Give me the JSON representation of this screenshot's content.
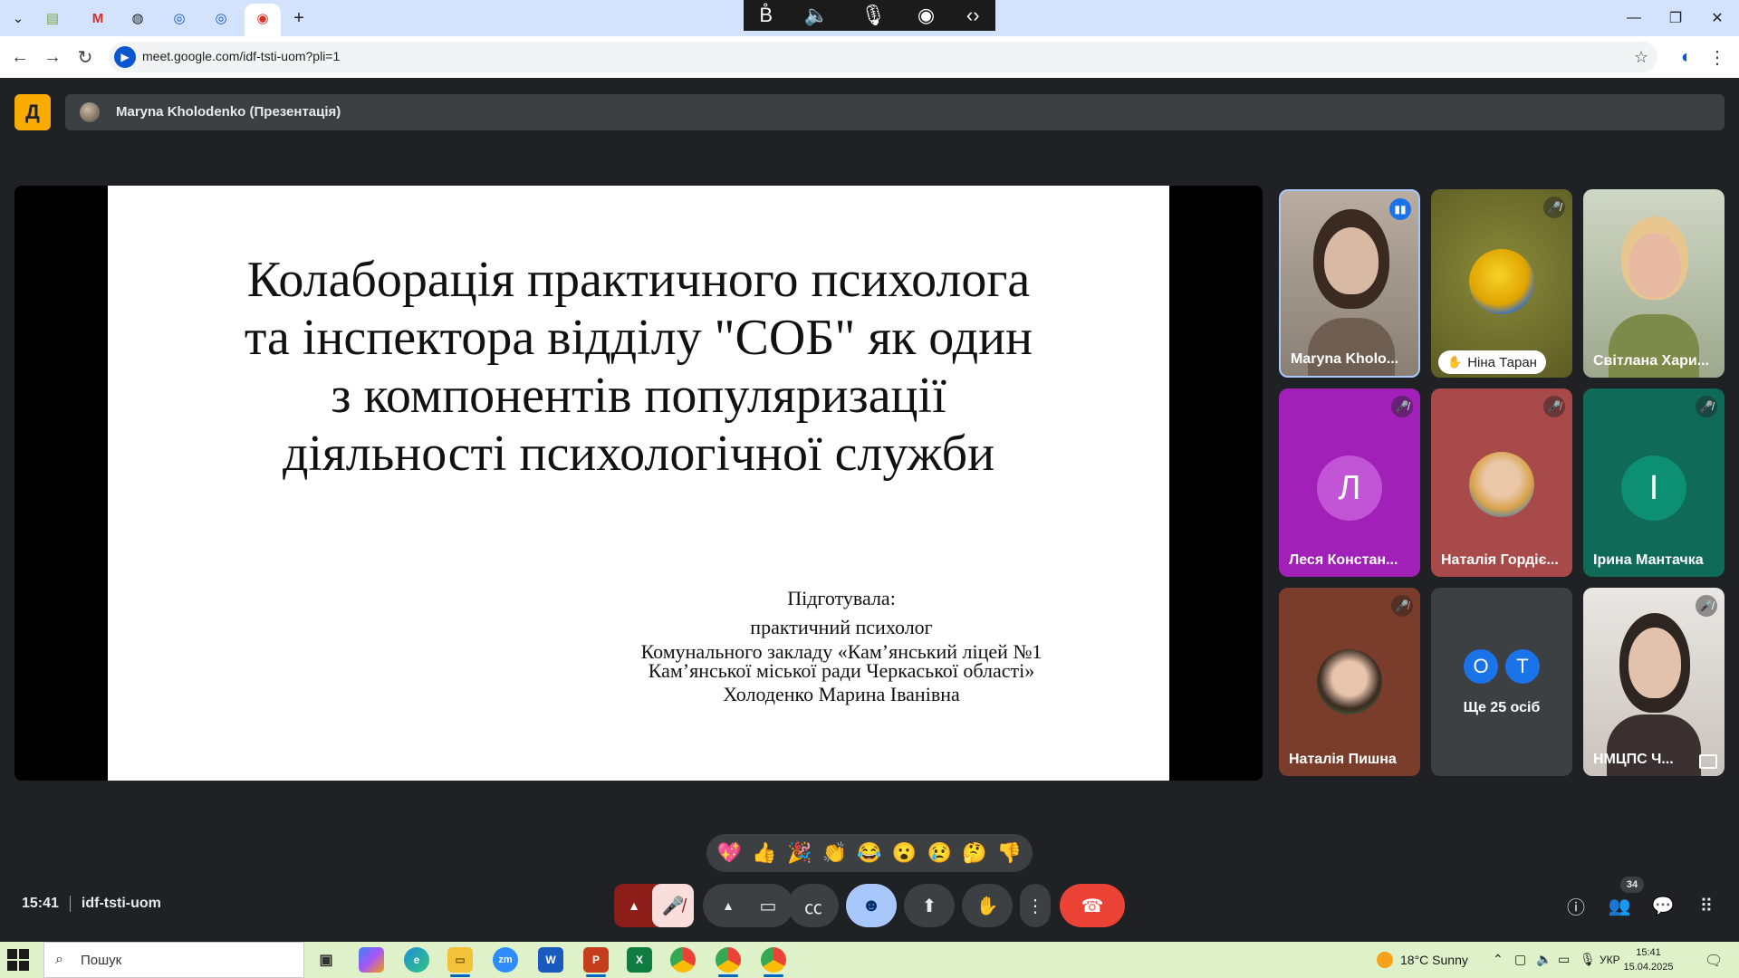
{
  "browser": {
    "url": "meet.google.com/idf-tsti-uom?pli=1",
    "media_overlay_icons": [
      "bo-icon",
      "speaker-icon",
      "mic-icon",
      "broadcast-icon",
      "code-icon"
    ]
  },
  "meet": {
    "logo_letter": "Д",
    "presentation_title": "Maryna Kholodenko (Презентація)",
    "slide": {
      "title": "Колаборація практичного психолога та інспектора відділу \"СОБ\" як один з компонентів популяризації діяльності психологічної служби",
      "prepared_by": "Підготувала:",
      "role": "практичний психолог",
      "org_line1": "Комунального закладу «Кам’янський ліцей №1",
      "org_line2": "Кам’янської міської ради Черкаської області»",
      "author": "Холоденко Марина Іванівна"
    },
    "participants": [
      {
        "name": "Maryna Kholo...",
        "speaking": true
      },
      {
        "name": "Ніна Таран",
        "muted": true,
        "hand_raised": true
      },
      {
        "name": "Світлана Хари..."
      },
      {
        "name": "Леся Констан...",
        "muted": true,
        "letter": "Л",
        "avatar_color": "#c255d6",
        "bg": "#a020b8"
      },
      {
        "name": "Наталія Гордіє...",
        "muted": true,
        "bg": "#a84a4a"
      },
      {
        "name": "Ірина Мантачка",
        "muted": true,
        "letter": "І",
        "avatar_color": "#0d8f73",
        "bg": "#0f6b58"
      },
      {
        "name": "Наталія Пишна",
        "muted": true,
        "bg": "#7a3d2c"
      },
      {
        "name": "Ще 25 осіб",
        "mini_avatars": [
          "О",
          "Т"
        ],
        "mini_colors": [
          "#1a73e8",
          "#1a73e8"
        ]
      },
      {
        "name": "НМЦПС Ч...",
        "muted": true
      }
    ],
    "reactions": [
      "💖",
      "👍",
      "🎉",
      "👏",
      "😂",
      "😮",
      "😢",
      "🤔",
      "👎"
    ],
    "time": "15:41",
    "meeting_code": "idf-tsti-uom",
    "people_count": "34",
    "colors": {
      "end_call": "#ea4335",
      "mic_off": "#f9dedc",
      "reactions_on": "#a8c7fa"
    }
  },
  "taskbar": {
    "search_placeholder": "Пошук",
    "weather": "18°C  Sunny",
    "language": "УКР",
    "clock_time": "15:41",
    "clock_date": "15.04.2025",
    "apps": [
      "task-view",
      "copilot",
      "edge",
      "file-explorer",
      "zoom",
      "word",
      "powerpoint",
      "excel",
      "chrome",
      "chrome-profile-1",
      "chrome-profile-2"
    ]
  }
}
